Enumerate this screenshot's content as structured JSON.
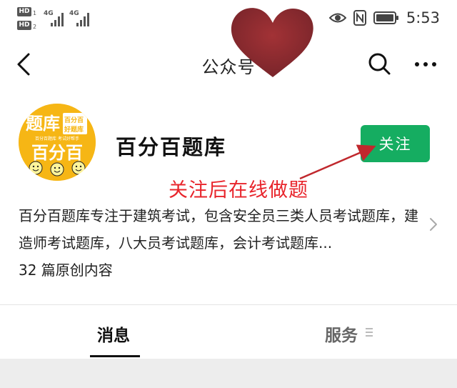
{
  "status_bar": {
    "sim1_badge": "HD",
    "sim1_index": "1",
    "sim2_badge": "HD",
    "sim2_index": "2",
    "net1": "4G",
    "net2": "4G",
    "time": "5:53",
    "icons": [
      "eye-icon",
      "nfc-icon",
      "battery-icon"
    ]
  },
  "nav": {
    "title": "公众号",
    "icons": [
      "back-icon",
      "search-icon",
      "more-icon"
    ]
  },
  "profile": {
    "logo": {
      "line1": "题库",
      "badge_line1": "百分百",
      "badge_line2": "好题库",
      "tagline": "百分百题库 考试好帮手",
      "line2": "百分百"
    },
    "name": "百分百题库",
    "follow_label": "关注",
    "annotation": "关注后在线做题",
    "description": "百分百题库专注于建筑考试，包含安全员三类人员考试题库，建造师考试题库，八大员考试题库，会计考试题库...",
    "article_count": "32 篇原创内容"
  },
  "tabs": [
    {
      "label": "消息",
      "active": true
    },
    {
      "label": "服务",
      "active": false
    }
  ],
  "colors": {
    "follow_green": "#15ad61",
    "annotation_red": "#e8242b",
    "logo_yellow": "#f6b615"
  }
}
